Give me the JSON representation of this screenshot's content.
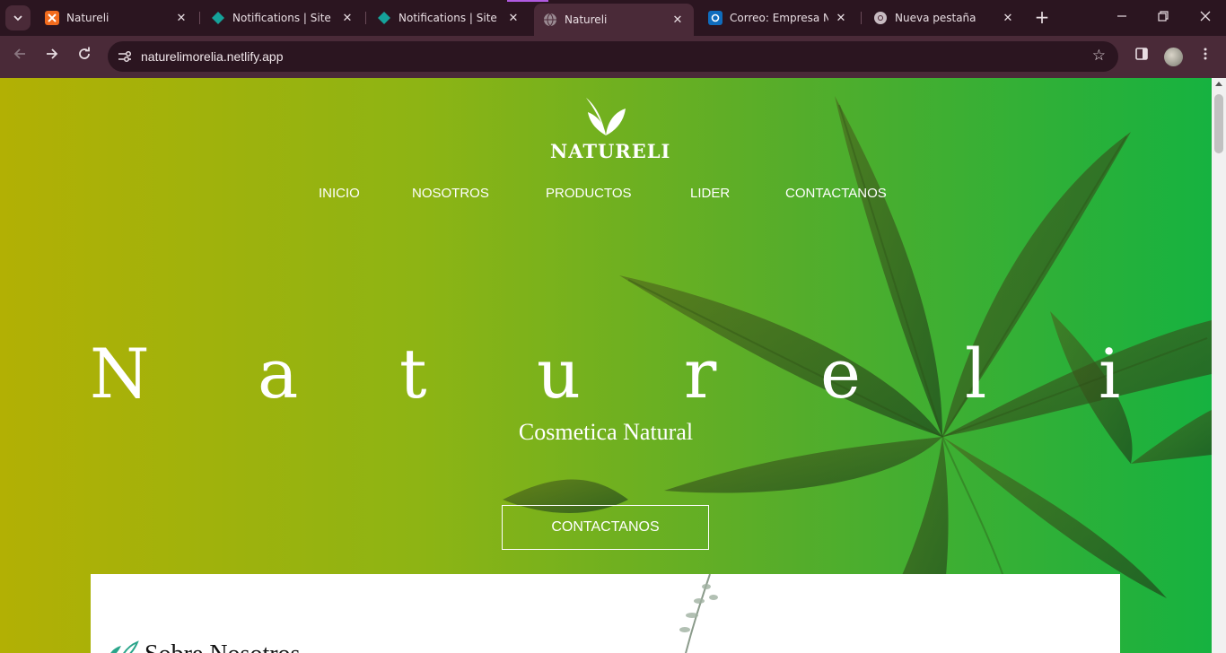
{
  "browser": {
    "tabs": [
      {
        "title": "Natureli",
        "favicon": "xampp-icon",
        "active": false
      },
      {
        "title": "Notifications | Site co",
        "favicon": "netlify-icon",
        "active": false
      },
      {
        "title": "Notifications | Site co",
        "favicon": "netlify-icon",
        "active": false
      },
      {
        "title": "Natureli",
        "favicon": "globe-icon",
        "active": true
      },
      {
        "title": "Correo: Empresa Natu",
        "favicon": "outlook-icon",
        "active": false
      },
      {
        "title": "Nueva pestaña",
        "favicon": "chrome-icon",
        "active": false
      }
    ],
    "url": "naturelimorelia.netlify.app",
    "colors": {
      "frame": "#2b1520",
      "toolbar": "#4a2a38",
      "accent": "#b05ae0"
    }
  },
  "site": {
    "logo_text": "NATURELI",
    "nav": [
      "INICIO",
      "NOSOTROS",
      "PRODUCTOS",
      "LIDER",
      "CONTACTANOS"
    ],
    "hero_title_letters": [
      "N",
      "a",
      "t",
      "u",
      "r",
      "e",
      "l",
      "i"
    ],
    "hero_subtitle": "Cosmetica Natural",
    "cta_label": "CONTACTANOS",
    "about_title": "Sobre Nosotros",
    "colors": {
      "gradient_start": "#b2b004",
      "gradient_end": "#16b240",
      "text": "#ffffff"
    }
  }
}
